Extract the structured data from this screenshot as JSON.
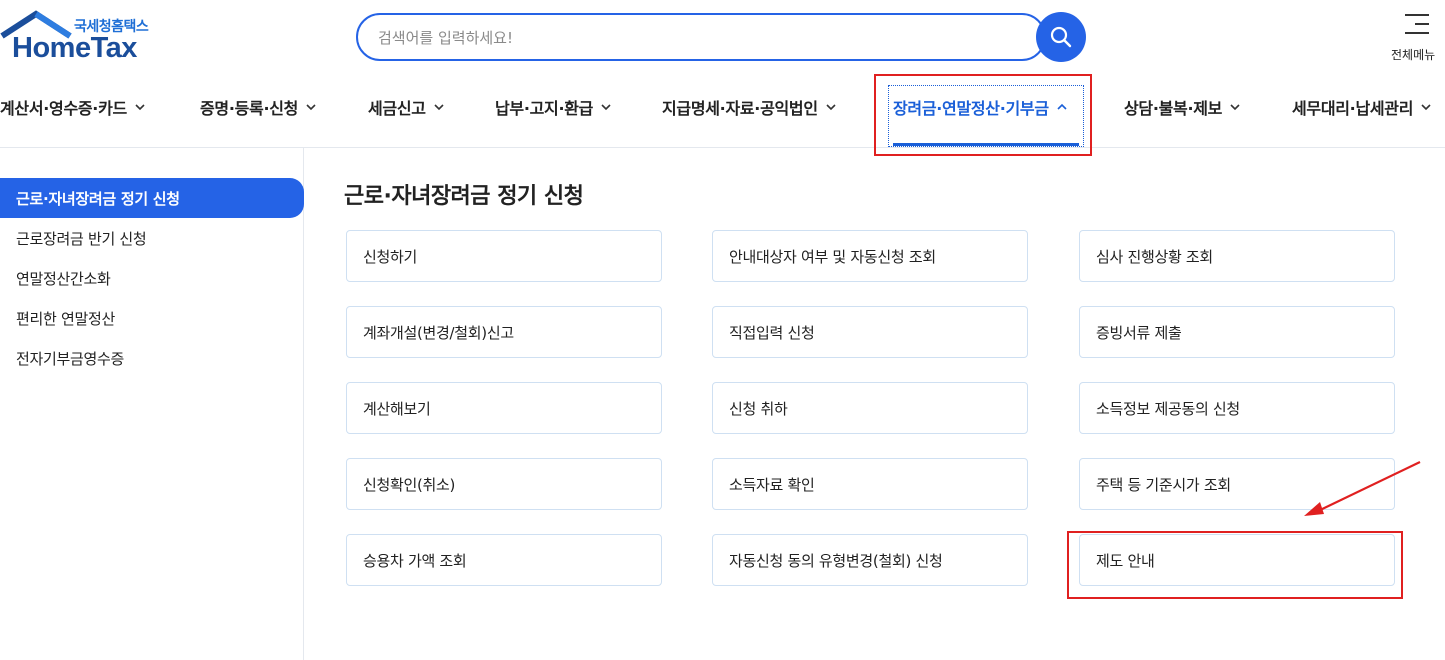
{
  "logo": {
    "sub": "국세청홈택스",
    "main": "HomeTax"
  },
  "search": {
    "placeholder": "검색어를 입력하세요!"
  },
  "all_menu": {
    "label": "전체메뉴"
  },
  "nav": [
    {
      "label": "계산서·영수증·카드"
    },
    {
      "label": "증명·등록·신청"
    },
    {
      "label": "세금신고"
    },
    {
      "label": "납부·고지·환급"
    },
    {
      "label": "지급명세·자료·공익법인"
    },
    {
      "label": "장려금·연말정산·기부금",
      "active": true
    },
    {
      "label": "상담·불복·제보"
    },
    {
      "label": "세무대리·납세관리"
    }
  ],
  "sidebar": {
    "items": [
      {
        "label": "근로·자녀장려금 정기 신청",
        "active": true
      },
      {
        "label": "근로장려금 반기 신청"
      },
      {
        "label": "연말정산간소화"
      },
      {
        "label": "편리한 연말정산"
      },
      {
        "label": "전자기부금영수증"
      }
    ]
  },
  "content": {
    "title": "근로·자녀장려금 정기 신청",
    "cards": [
      "신청하기",
      "안내대상자 여부 및 자동신청 조회",
      "심사 진행상황 조회",
      "계좌개설(변경/철회)신고",
      "직접입력 신청",
      "증빙서류 제출",
      "계산해보기",
      "신청 취하",
      "소득정보 제공동의 신청",
      "신청확인(취소)",
      "소득자료 확인",
      "주택 등 기준시가 조회",
      "승용차 가액 조회",
      "자동신청 동의 유형변경(철회) 신청",
      "제도 안내"
    ]
  },
  "colors": {
    "accent": "#2563e6",
    "annotation": "#e02020"
  }
}
